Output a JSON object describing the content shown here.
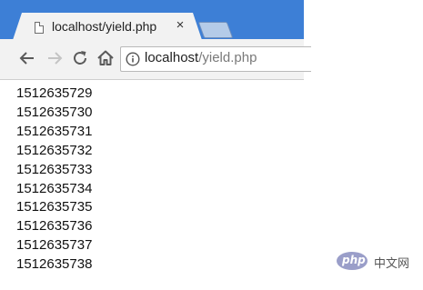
{
  "browser": {
    "tab": {
      "title": "localhost/yield.php",
      "close_glyph": "×",
      "page_icon": "page-icon"
    },
    "toolbar": {
      "back_icon": "back-arrow-icon",
      "forward_icon": "forward-arrow-icon",
      "reload_icon": "reload-icon",
      "home_icon": "home-icon",
      "info_icon": "info-icon"
    },
    "address": {
      "host": "localhost",
      "path": "/yield.php"
    }
  },
  "page": {
    "lines": [
      "1512635729",
      "1512635730",
      "1512635731",
      "1512635732",
      "1512635733",
      "1512635734",
      "1512635735",
      "1512635736",
      "1512635737",
      "1512635738"
    ]
  },
  "watermark": {
    "logo_text": "php",
    "site_text": "中文网"
  },
  "colors": {
    "titlebar": "#3d7fd6",
    "tab": "#f2f2f2",
    "toolbar": "#f2f2f2",
    "url_path": "#7a7a7a",
    "watermark_logo": "#9a9ec9"
  }
}
